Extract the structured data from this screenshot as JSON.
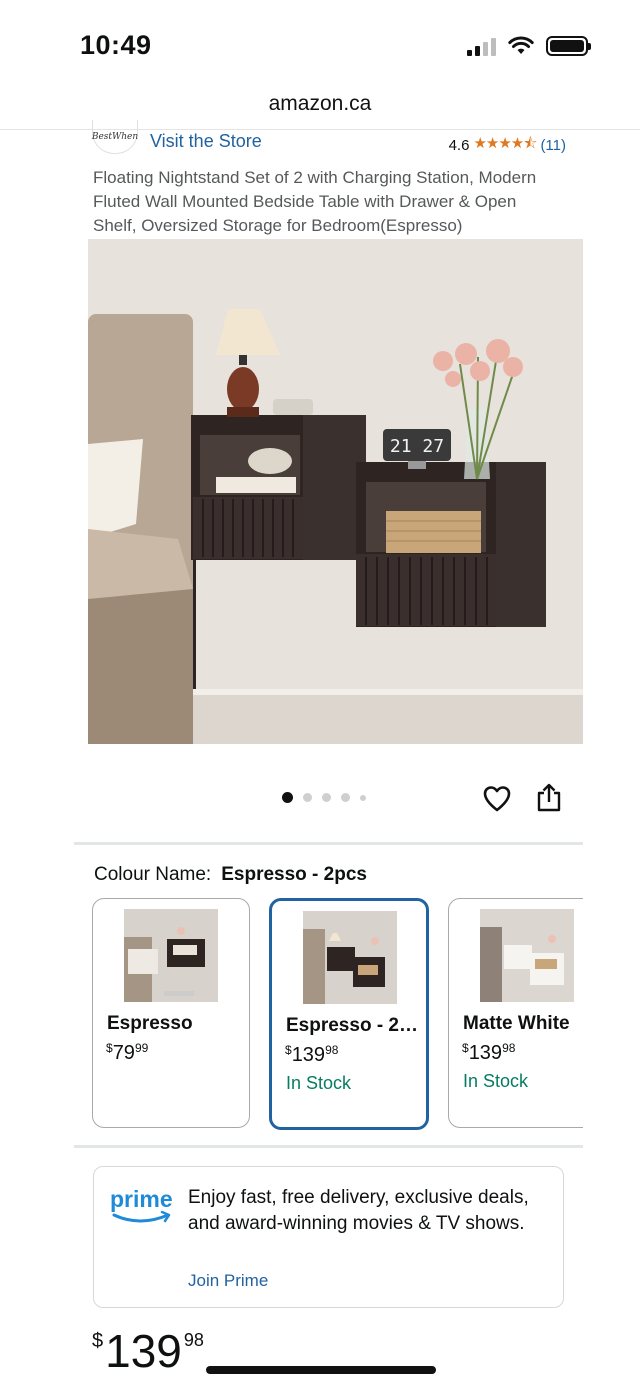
{
  "status_bar": {
    "time": "10:49"
  },
  "browser": {
    "url": "amazon.ca"
  },
  "store": {
    "logo_text": "BestWhen",
    "visit_label": "Visit the Store",
    "rating": "4.6",
    "stars": "★★★★⯪",
    "review_count": "(11)"
  },
  "product": {
    "title": "Floating Nightstand Set of 2 with Charging Station, Modern Fluted Wall Mounted Bedside Table with Drawer & Open Shelf, Oversized Storage for Bedroom(Espresso)",
    "image_clock_text": "21 27",
    "carousel": {
      "count": 5,
      "active_index": 0
    }
  },
  "colour": {
    "label": "Colour Name:",
    "selected_value": "Espresso - 2pcs",
    "options": [
      {
        "name": "Espresso",
        "price_dollars": "79",
        "price_cents": "99",
        "stock": ""
      },
      {
        "name": "Espresso - 2pcs",
        "price_dollars": "139",
        "price_cents": "98",
        "stock": "In Stock"
      },
      {
        "name": "Matte White",
        "price_dollars": "139",
        "price_cents": "98",
        "stock": "In Stock"
      }
    ]
  },
  "prime": {
    "logo_text": "prime",
    "message": "Enjoy fast, free delivery, exclusive deals, and award-winning movies & TV shows.",
    "join_label": "Join Prime"
  },
  "buy_box": {
    "currency": "$",
    "price_dollars": "139",
    "price_cents": "98"
  },
  "colors": {
    "link_blue": "#2162a1",
    "star_orange": "#de7921",
    "in_stock_green": "#067d62",
    "espresso": "#2e2523"
  },
  "icons": [
    "signal-icon",
    "wifi-icon",
    "battery-icon",
    "heart-icon",
    "share-icon",
    "prime-logo-icon"
  ]
}
